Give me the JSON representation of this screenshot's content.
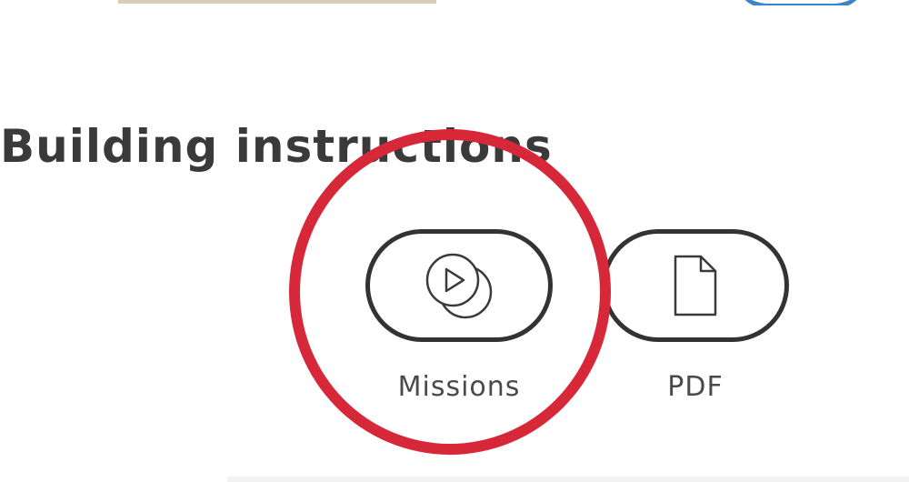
{
  "section": {
    "title": "Building instructions"
  },
  "options": [
    {
      "label": "Missions",
      "icon": "play-stack-icon"
    },
    {
      "label": "PDF",
      "icon": "document-icon"
    }
  ],
  "colors": {
    "highlight_ring": "#d7283a",
    "button_border": "#333333",
    "text": "#3a3a3a"
  }
}
